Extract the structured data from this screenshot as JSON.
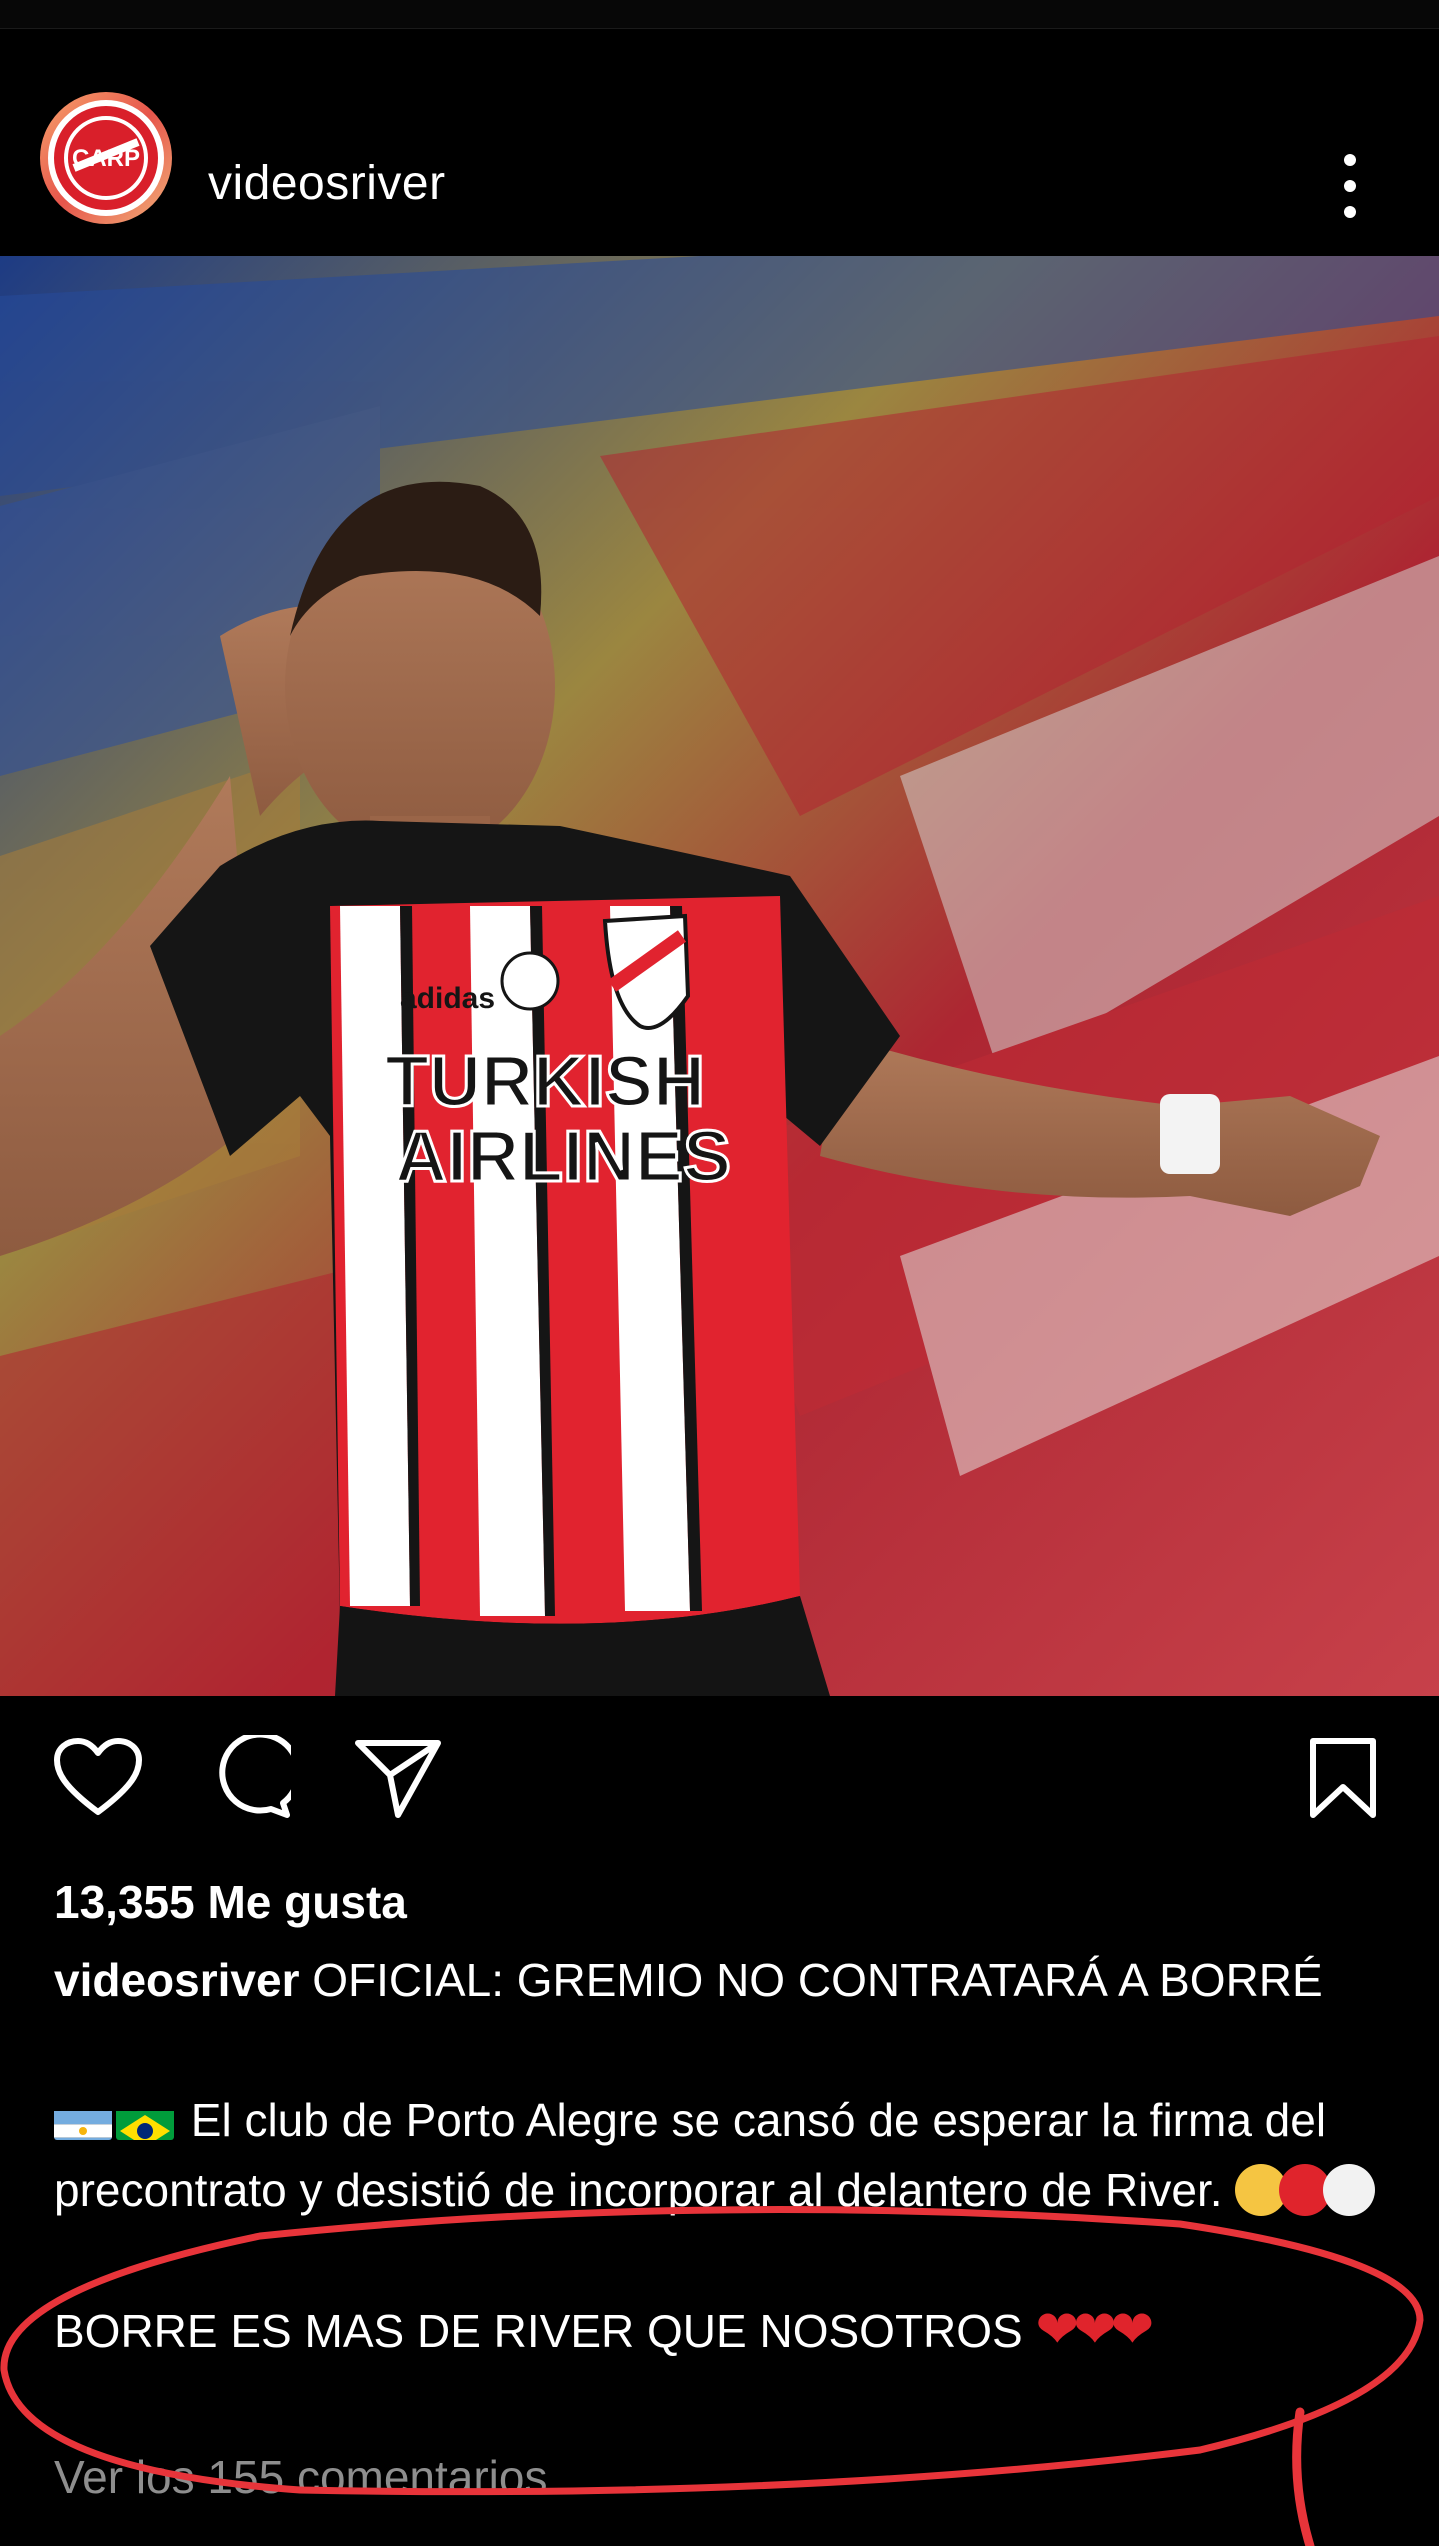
{
  "header": {
    "username": "videosriver",
    "avatar_text": "CARP",
    "more_icon": "more-vertical-icon"
  },
  "post": {
    "image_alt": "River Plate player saluting",
    "jersey_sponsor_line1": "TURKISH",
    "jersey_sponsor_line2": "AIRLINES",
    "jersey_brand": "adidas"
  },
  "actions": {
    "like_icon": "heart-icon",
    "comment_icon": "comment-icon",
    "share_icon": "send-icon",
    "save_icon": "bookmark-icon"
  },
  "likes": {
    "text": "13,355 Me gusta"
  },
  "caption": {
    "username": "videosriver",
    "headline": "OFICIAL: GREMIO NO CONTRATARÁ A BORRÉ",
    "body": "El club de Porto Alegre se cansó de esperar la firma del precontrato y desistió de incorporar al delantero de River.",
    "shout": "BORRE ES MAS DE RIVER QUE NOSOTROS",
    "hearts": "❤❤❤"
  },
  "comments": {
    "view_text": "Ver los 155 comentarios"
  },
  "colors": {
    "background": "#000000",
    "text": "#ffffff",
    "muted": "#8e8e8e",
    "annotation": "#e8343a",
    "river_red": "#d91f2a"
  }
}
